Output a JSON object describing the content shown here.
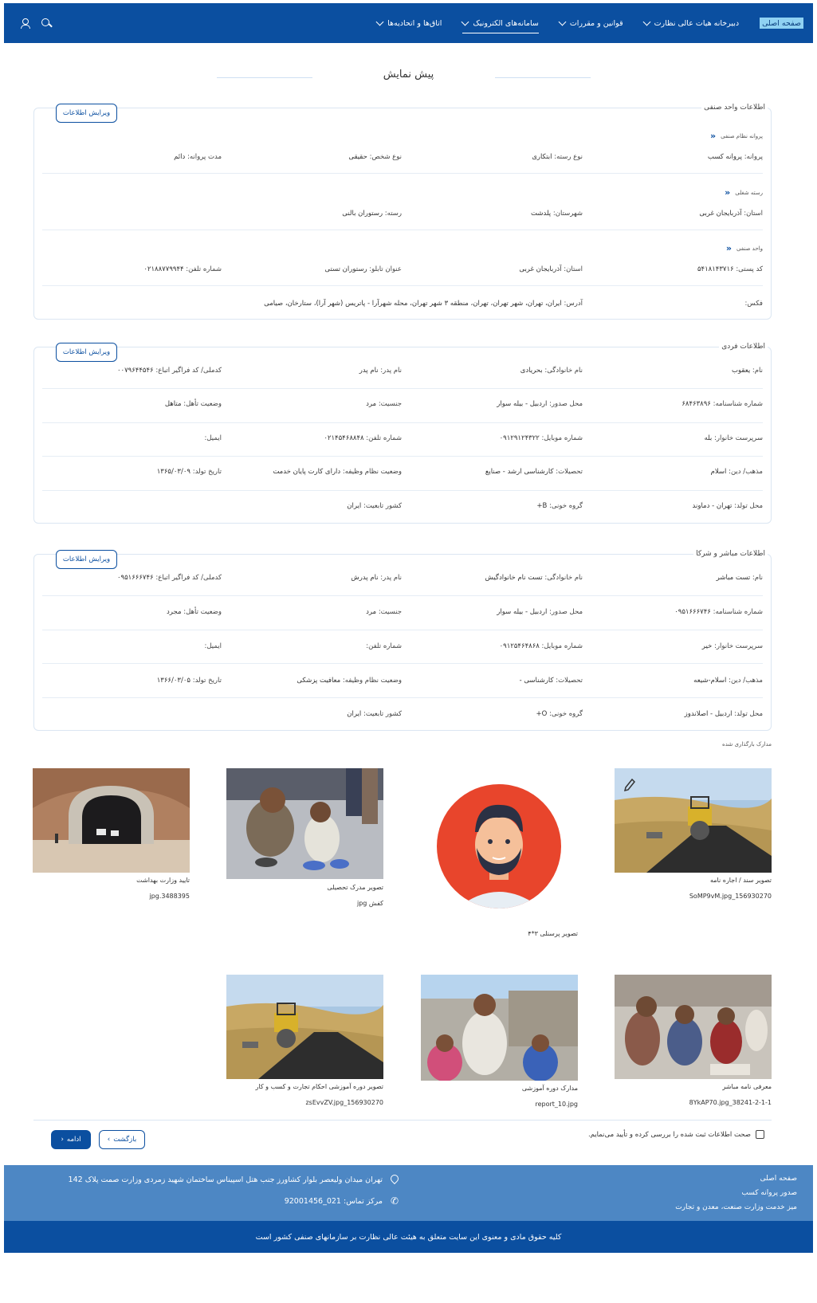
{
  "nav": {
    "items": [
      {
        "label": "صفحه اصلی",
        "has_dropdown": false
      },
      {
        "label": "دبیرخانه هیات عالی نظارت",
        "has_dropdown": true
      },
      {
        "label": "قوانین و مقررات",
        "has_dropdown": true
      },
      {
        "label": "سامانه‌های الکترونیک",
        "has_dropdown": true
      },
      {
        "label": "اتاق‌ها و اتحادیه‌ها",
        "has_dropdown": true
      }
    ]
  },
  "page_title": "پیش نمایش",
  "edit_label": "ویرایش اطلاعات",
  "sections": {
    "unit": {
      "title": "اطلاعات واحد صنفی",
      "sub1": "پروانه نظام صنفی",
      "sub2": "رسته شغلی",
      "sub3": "واحد صنفی",
      "f": {
        "license_k": "پروانه:",
        "license_v": "پروانه کسب",
        "rasteh_type_k": "نوع رسته:",
        "rasteh_type_v": "ابتکاری",
        "person_type_k": "نوع شخص:",
        "person_type_v": "حقیقی",
        "duration_k": "مدت پروانه:",
        "duration_v": "دائم",
        "province_k": "استان:",
        "province_v": "آذربایجان غربی",
        "city_k": "شهرستان:",
        "city_v": "پلدشت",
        "rasteh_k": "رسته:",
        "rasteh_v": "رستوران بالنی",
        "postal_k": "کد پستی:",
        "postal_v": "۵۴۱۸۱۴۳۷۱۶",
        "province2_k": "استان:",
        "province2_v": "آذربایجان غربی",
        "sign_k": "عنوان تابلو:",
        "sign_v": "رستوران تستی",
        "phone_k": "شماره تلفن:",
        "phone_v": "۰۲۱۸۸۷۷۹۹۴۴",
        "fax_k": "فکس:",
        "fax_v": "",
        "address_k": "آدرس:",
        "address_v": "ایران، تهران، شهر تهران، تهران، منطقه ۳ شهر تهران، محله شهرآرا - پاتریس (شهر آرا)، ستارخان، صیامی"
      }
    },
    "personal": {
      "title": "اطلاعات فردی",
      "f": {
        "name_k": "نام:",
        "name_v": "یعقوب",
        "family_k": "نام خانوادگی:",
        "family_v": "بحریادی",
        "father_k": "نام پدر:",
        "father_v": "نام پدر",
        "code_k": "کدملی/ کد فراگیر اتباع:",
        "code_v": "۰۰۷۹۶۴۴۵۴۶",
        "idno_k": "شماره شناسنامه:",
        "idno_v": "۶۸۴۶۳۸۹۶",
        "issue_k": "محل صدور:",
        "issue_v": "اردبیل - بیله سوار",
        "gender_k": "جنسیت:",
        "gender_v": "مرد",
        "marital_k": "وضعیت تأهل:",
        "marital_v": "متاهل",
        "head_k": "سرپرست خانوار:",
        "head_v": "بله",
        "mobile_k": "شماره موبایل:",
        "mobile_v": "۰۹۱۲۹۱۲۴۳۲۲",
        "tel_k": "شماره تلفن:",
        "tel_v": "۰۲۱۴۵۴۶۸۸۴۸",
        "email_k": "ایمیل:",
        "email_v": "",
        "religion_k": "مذهب/ دین:",
        "religion_v": "اسلام",
        "edu_k": "تحصیلات:",
        "edu_v": "کارشناسی ارشد - صنایع",
        "military_k": "وضعیت نظام وظیفه:",
        "military_v": "دارای کارت پایان خدمت",
        "birth_k": "تاریخ تولد:",
        "birth_v": "۱۳۶۵/۰۳/۰۹",
        "birthplace_k": "محل تولد:",
        "birthplace_v": "تهران - دماوند",
        "blood_k": "گروه خونی:",
        "blood_v": "B+",
        "nation_k": "کشور تابعیت:",
        "nation_v": "ایران"
      }
    },
    "partners": {
      "title": "اطلاعات مباشر و شرکا",
      "f": {
        "name_k": "نام:",
        "name_v": "تست مباشر",
        "family_k": "نام خانوادگی:",
        "family_v": "تست نام خانوادگیش",
        "father_k": "نام پدر:",
        "father_v": "نام پدرش",
        "code_k": "کدملی/ کد فراگیر اتباع:",
        "code_v": "۰۹۵۱۶۶۶۷۴۶",
        "idno_k": "شماره شناسنامه:",
        "idno_v": "۰۹۵۱۶۶۶۷۴۶",
        "issue_k": "محل صدور:",
        "issue_v": "اردبیل - بیله سوار",
        "gender_k": "جنسیت:",
        "gender_v": "مرد",
        "marital_k": "وضعیت تأهل:",
        "marital_v": "مجرد",
        "head_k": "سرپرست خانوار:",
        "head_v": "خیر",
        "mobile_k": "شماره موبایل:",
        "mobile_v": "۰۹۱۲۵۴۶۴۸۶۸",
        "tel_k": "شماره تلفن:",
        "tel_v": "",
        "email_k": "ایمیل:",
        "email_v": "",
        "religion_k": "مذهب/ دین:",
        "religion_v": "اسلام-شیعه",
        "edu_k": "تحصیلات:",
        "edu_v": "کارشناسی -",
        "military_k": "وضعیت نظام وظیفه:",
        "military_v": "معافیت پزشکی",
        "birth_k": "تاریخ تولد:",
        "birth_v": "۱۳۶۶/۰۳/۰۵",
        "birthplace_k": "محل تولد:",
        "birthplace_v": "اردبیل - اصلاندوز",
        "blood_k": "گروه خونی:",
        "blood_v": "O+",
        "nation_k": "کشور تابعیت:",
        "nation_v": "ایران"
      }
    }
  },
  "docs": {
    "label": "مدارک بارگذاری شده",
    "items": [
      {
        "caption": "تصویر سند / اجاره نامه",
        "file": "SoMP9vM.jpg_156930270"
      },
      {
        "caption": "تصویر پرسنلی ۳*۴",
        "file": ""
      },
      {
        "caption": "تصویر مدرک تحصیلی",
        "file": "کفش jpg"
      },
      {
        "caption": "تایید وزارت بهداشت",
        "file": "jpg.3488395"
      },
      {
        "caption": "معرفی نامه مباشر",
        "file": "8YkAP70.jpg_38241-2-1-1"
      },
      {
        "caption": "مدارک دوره آموزشی",
        "file": "report_10.jpg"
      },
      {
        "caption": "تصویر دوره آموزشی احکام تجارت و کسب و کار",
        "file": "zsEvvZV.jpg_156930270"
      }
    ]
  },
  "confirm_text": "صحت اطلاعات ثبت شده را بررسی کرده و تأیید می‌نمایم.",
  "buttons": {
    "continue": "ادامه",
    "back": "بازگشت"
  },
  "footer": {
    "links": [
      "صفحه اصلی",
      "صدور پروانه کسب",
      "میز خدمت وزارت صنعت، معدن و تجارت"
    ],
    "address": "تهران میدان ولیعصر بلوار کشاورز جنب هتل اسپیناس ساختمان شهید زمردی وزارت صمت پلاک 142",
    "phone": "مرکز تماس: 021_92001456",
    "copyright": "کلیه حقوق مادی و معنوی این سایت متعلق به هیئت عالی نظارت بر سازمانهای صنفی کشور است"
  },
  "colors": {
    "brand": "#0b4fa0",
    "footer": "#4d87c4",
    "home_highlight": "#8fd1f2"
  }
}
